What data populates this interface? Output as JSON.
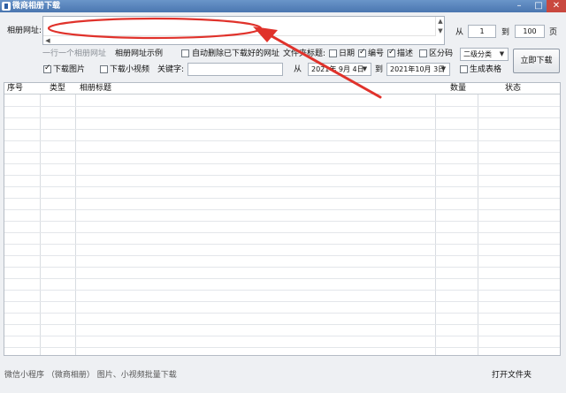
{
  "window": {
    "title": "微商相册下载"
  },
  "url_section": {
    "label": "相册网址:",
    "hint": "一行一个相册网址",
    "example_link": "相册网址示例",
    "auto_delete_label": "自动删除已下载好的网址",
    "auto_delete_checked": false
  },
  "pages": {
    "from_label": "从",
    "from_value": "1",
    "to_label": "到",
    "to_value": "100",
    "unit_label": "页"
  },
  "file_title": {
    "label": "文件夹标题:",
    "date_label": "日期",
    "date_checked": false,
    "number_label": "编号",
    "number_checked": true,
    "desc_label": "描述",
    "desc_checked": true,
    "partition_label": "区分码",
    "partition_checked": false,
    "category_value": "二级分类"
  },
  "options": {
    "download_images_label": "下载图片",
    "download_images_checked": true,
    "download_video_label": "下载小视频",
    "download_video_checked": false,
    "keyword_label": "关键字:",
    "keyword_value": ""
  },
  "date_range": {
    "from_label": "从",
    "from_value": "2021年 9月 4日",
    "to_label": "到",
    "to_value": "2021年10月 3日"
  },
  "table_option": {
    "generate_table_label": "生成表格",
    "generate_table_checked": false
  },
  "actions": {
    "download_now_label": "立即下载",
    "open_folder_label": "打开文件夹"
  },
  "table": {
    "columns": [
      "序号",
      "类型",
      "相册标题",
      "数量",
      "状态"
    ],
    "rows": []
  },
  "footer": {
    "text": "微信小程序 （微商相册） 图片、小视频批量下载"
  },
  "colors": {
    "annotation_red": "#e0322b",
    "titlebar": "#4a76b0"
  }
}
